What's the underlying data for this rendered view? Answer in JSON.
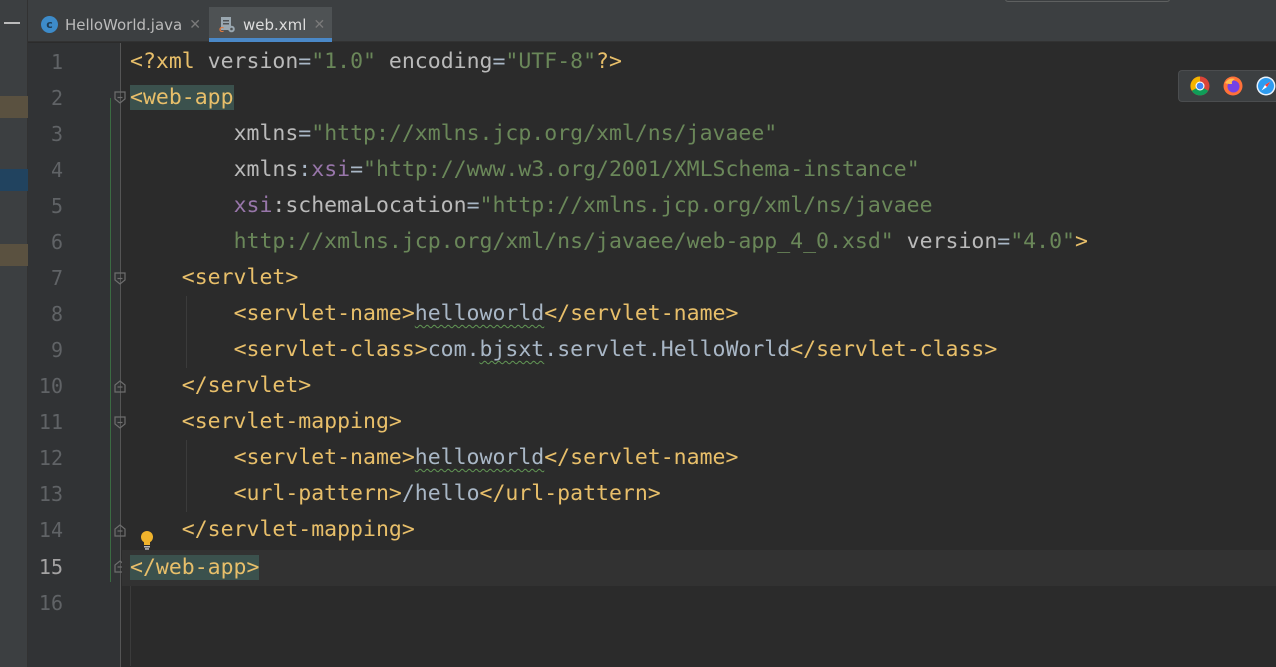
{
  "tabs": [
    {
      "label": "HelloWorld.java",
      "icon": "java-class-icon",
      "active": false
    },
    {
      "label": "web.xml",
      "icon": "xml-config-icon",
      "active": true
    }
  ],
  "editor": {
    "current_line": 15,
    "line_numbers": [
      "1",
      "2",
      "3",
      "4",
      "5",
      "6",
      "7",
      "8",
      "9",
      "10",
      "11",
      "12",
      "13",
      "14",
      "15",
      "16"
    ],
    "code": {
      "l1": {
        "p1": "<?xml ",
        "p2": "version",
        "p3": "=",
        "p4": "\"1.0\"",
        "p5": " encoding",
        "p6": "=",
        "p7": "\"UTF-8\"",
        "p8": "?>"
      },
      "l2": {
        "p1": "<web-app"
      },
      "l3": {
        "p1": "xmlns",
        "p2": "=",
        "p3": "\"http://xmlns.jcp.org/xml/ns/javaee\""
      },
      "l4": {
        "p1": "xmlns",
        "p2": ":",
        "p3": "xsi",
        "p4": "=",
        "p5": "\"http://www.w3.org/2001/XMLSchema-instance\""
      },
      "l5": {
        "p1": "xsi",
        "p2": ":schemaLocation",
        "p3": "=",
        "p4": "\"http://xmlns.jcp.org/xml/ns/javaee"
      },
      "l6": {
        "p1": "http://xmlns.jcp.org/xml/ns/javaee/web-app_4_0.xsd\"",
        "p2": " version",
        "p3": "=",
        "p4": "\"4.0\"",
        "p5": ">"
      },
      "l7": {
        "p1": "<servlet>"
      },
      "l8": {
        "p1": "<servlet-name>",
        "p2": "helloworld",
        "p3": "</servlet-name>"
      },
      "l9": {
        "p1": "<servlet-class>",
        "p2": "com.",
        "p3": "bjsxt",
        "p4": ".servlet.HelloWorld",
        "p5": "</servlet-class>"
      },
      "l10": {
        "p1": "</servlet>"
      },
      "l11": {
        "p1": "<servlet-mapping>"
      },
      "l12": {
        "p1": "<servlet-name>",
        "p2": "helloworld",
        "p3": "</servlet-name>"
      },
      "l13": {
        "p1": "<url-pattern>",
        "p2": "/hello",
        "p3": "</url-pattern>"
      },
      "l14": {
        "p1": "</servlet-mapping>"
      },
      "l15": {
        "p1": "</web-app",
        "p2": ">"
      }
    }
  },
  "browsers": [
    "chrome-icon",
    "firefox-icon",
    "safari-icon"
  ],
  "colors": {
    "background": "#2b2b2b",
    "tag": "#e8bf6a",
    "attribute": "#bababa",
    "namespace": "#9876aa",
    "string": "#6a8759",
    "text": "#a9b7c6",
    "tab_underline": "#4a88c7"
  }
}
